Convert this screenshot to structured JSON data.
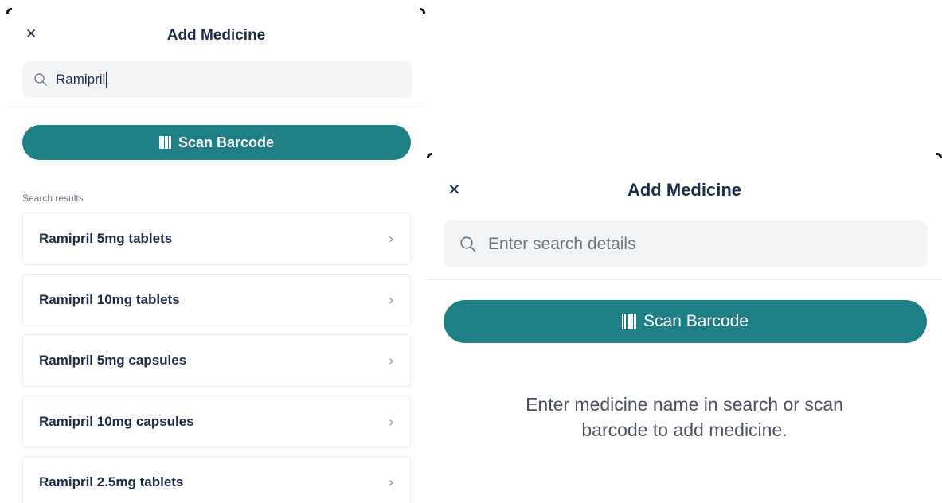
{
  "left_screen": {
    "close_glyph": "✕",
    "title": "Add Medicine",
    "search": {
      "value": "Ramipril",
      "icon": "search-icon"
    },
    "scan_button": {
      "label": "Scan Barcode",
      "icon": "barcode-icon"
    },
    "results_label": "Search results",
    "results": [
      {
        "label": "Ramipril 5mg tablets"
      },
      {
        "label": "Ramipril 10mg tablets"
      },
      {
        "label": "Ramipril 5mg capsules"
      },
      {
        "label": "Ramipril 10mg capsules"
      },
      {
        "label": "Ramipril 2.5mg tablets"
      }
    ],
    "chevron_glyph": "›"
  },
  "right_screen": {
    "close_glyph": "✕",
    "title": "Add Medicine",
    "search": {
      "placeholder": "Enter search details",
      "icon": "search-icon"
    },
    "scan_button": {
      "label": "Scan Barcode",
      "icon": "barcode-icon"
    },
    "helper_line1": "Enter medicine name in search or scan",
    "helper_line2": "barcode to add medicine."
  },
  "colors": {
    "accent": "#1e7f86",
    "text": "#1c2b4a",
    "search_bg": "#f3f4f5"
  }
}
